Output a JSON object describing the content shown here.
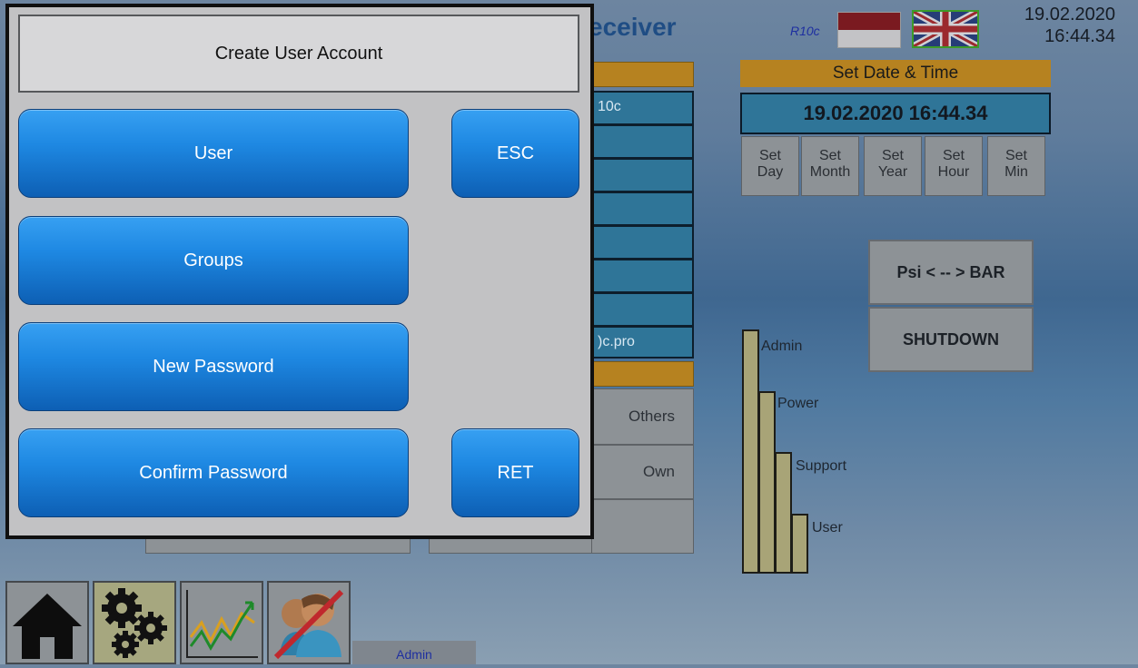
{
  "header": {
    "title_partial": "eceiver",
    "version": "R10c",
    "date": "19.02.2020",
    "time": "16:44.34"
  },
  "background_panel": {
    "field_partial_1": "10c",
    "field_partial_2": ")c.pro"
  },
  "permissions": {
    "others_label": "Others",
    "own_label": "Own"
  },
  "datetime_panel": {
    "title": "Set Date & Time",
    "display": "19.02.2020 16:44.34",
    "set_day": [
      "Set",
      "Day"
    ],
    "set_month": [
      "Set",
      "Month"
    ],
    "set_year": [
      "Set",
      "Year"
    ],
    "set_hour": [
      "Set",
      "Hour"
    ],
    "set_min": [
      "Set",
      "Min"
    ]
  },
  "actions": {
    "unit_toggle": "Psi < -- > BAR",
    "shutdown": "SHUTDOWN"
  },
  "access_levels": {
    "admin": "Admin",
    "power": "Power",
    "support": "Support",
    "user": "User"
  },
  "modal": {
    "title": "Create User Account",
    "user": "User",
    "groups": "Groups",
    "new_password": "New Password",
    "confirm_password": "Confirm Password",
    "esc": "ESC",
    "ret": "RET"
  },
  "nav": {
    "home_icon": "home-icon",
    "settings_icon": "gears-icon",
    "trend_icon": "trend-chart-icon",
    "users_icon": "users-crossed-icon",
    "current_user": "Admin"
  },
  "colors": {
    "accent_blue": "#1e88e2",
    "orange_header": "#b68220",
    "field_blue": "#2f7598"
  }
}
